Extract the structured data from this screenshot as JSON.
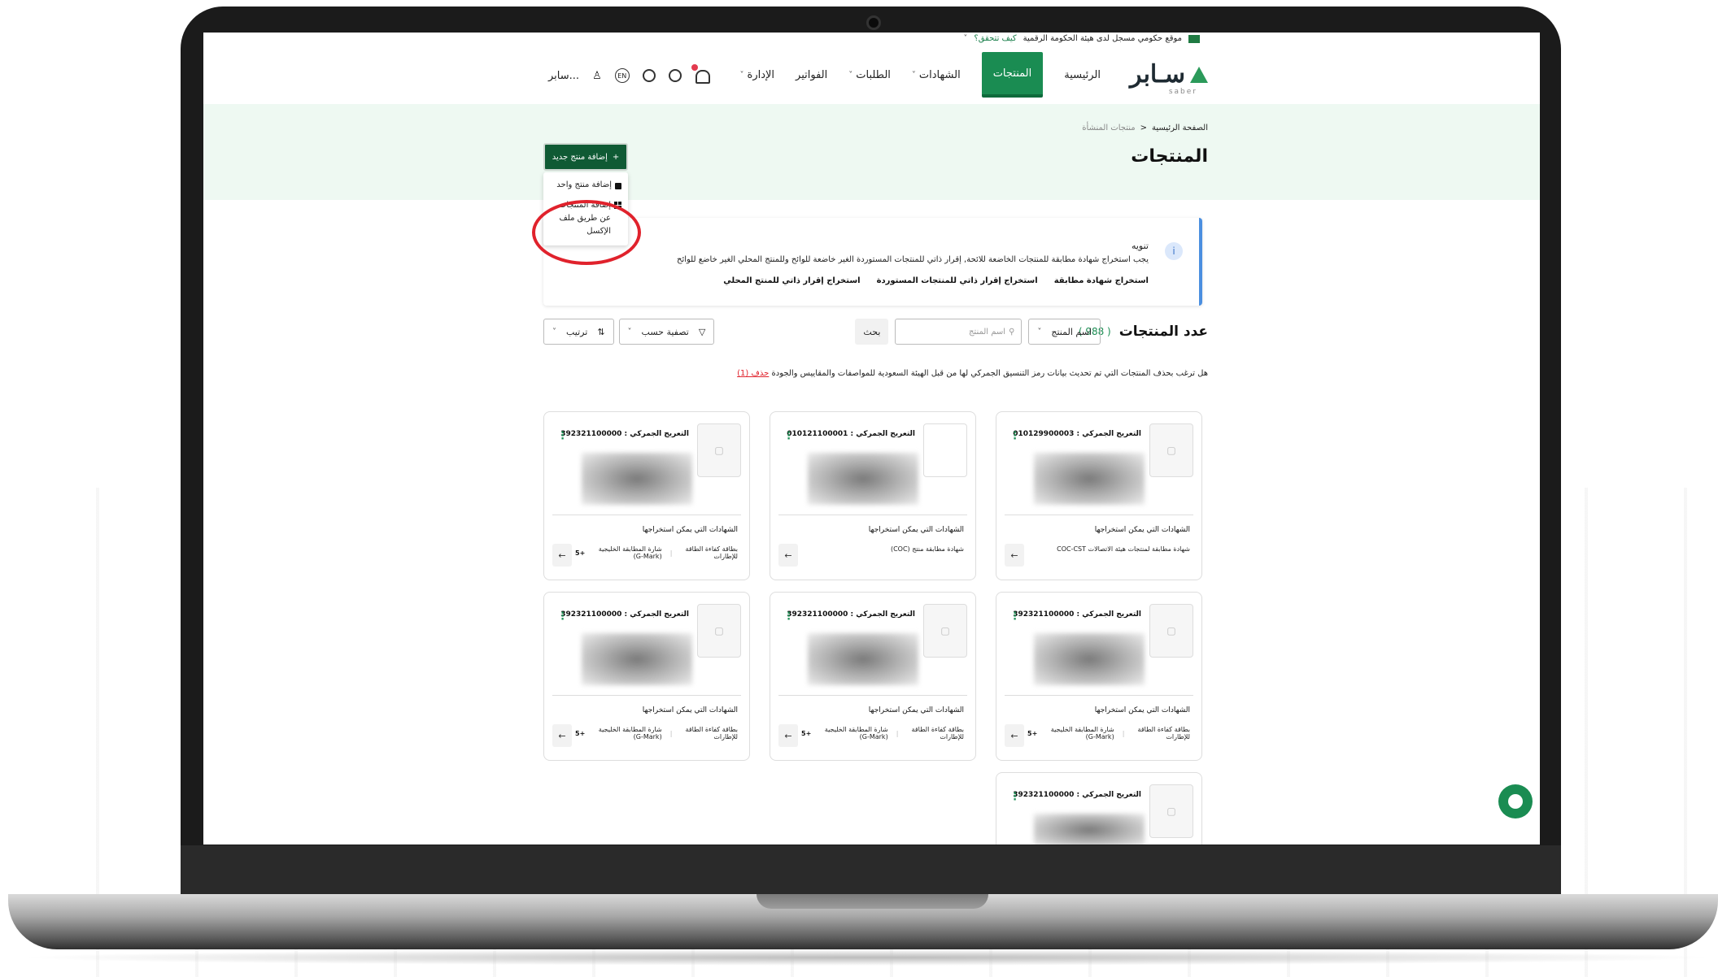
{
  "gov_bar": {
    "text": "موقع حكومي مسجل لدى هيئة الحكومة الرقمية",
    "link": "كيف تتحقق؟"
  },
  "brand": {
    "name": "سـابر",
    "sub": "saber"
  },
  "nav": {
    "items": [
      {
        "label": "الرئيسية",
        "active": false,
        "has_menu": false
      },
      {
        "label": "المنتجات",
        "active": true,
        "has_menu": false
      },
      {
        "label": "الشهادات",
        "active": false,
        "has_menu": true
      },
      {
        "label": "الطلبات",
        "active": false,
        "has_menu": true
      },
      {
        "label": "الفواتير",
        "active": false,
        "has_menu": false
      },
      {
        "label": "الإدارة",
        "active": false,
        "has_menu": true
      }
    ],
    "lang": "EN",
    "user": "سابر..."
  },
  "breadcrumb": {
    "home": "الصفحة الرئيسية",
    "separator": "<",
    "current": "منتجات المنشأة"
  },
  "page_title": "المنتجات",
  "add_button": {
    "label": "إضافة منتج جديد",
    "icon": "+"
  },
  "dropdown": {
    "single": "إضافة منتج واحد",
    "excel": "إضافة المنتجات عن طريق ملف الإكسل"
  },
  "notice": {
    "title": "تنويه",
    "text": "يجب استخراج شهادة مطابقة للمنتجات الخاضعة للائحة, إقرار ذاتي للمنتجات المستوردة الغير خاضعة للوائح وللمنتج المحلي الغير خاضع للوائح",
    "links": [
      "استخراج شهادة مطابقة",
      "استخراج إقرار ذاتي للمنتجات المستوردة",
      "استخراج إقرار ذاتي للمنتج المحلي"
    ]
  },
  "count": {
    "label": "عدد المنتجات",
    "value": "( 988 )"
  },
  "filters": {
    "field_select": "اسم المنتج",
    "search_placeholder": "اسم المنتج",
    "search_button": "بحث",
    "filter_by": "تصفية حسب",
    "sort": "ترتيب"
  },
  "question": {
    "text": "هل ترغب بحذف المنتجات التي تم تحديث بيانات رمز التنسيق الجمركي لها من قبل الهيئة السعودية للمواصفات والمقاييس والجودة",
    "link": "حذف (1)"
  },
  "cards": [
    {
      "tariff": "التعريج الجمركي : 010129900003",
      "certs_label": "الشهادات التي يمكن استخراجها",
      "certs": [
        "شهادة مطابقة لمنتجات هيئة الاتصالات COC-CST"
      ],
      "more": ""
    },
    {
      "tariff": "التعريج الجمركي : 010121100001",
      "certs_label": "الشهادات التي يمكن استخراجها",
      "certs": [
        "شهادة مطابقة منتج (COC)"
      ],
      "more": ""
    },
    {
      "tariff": "التعريج الجمركي : 392321100000",
      "certs_label": "الشهادات التي يمكن استخراجها",
      "certs": [
        "بطاقة كفاءة الطاقة للإطارات",
        "شارة المطابقة الخليجية (G-Mark)"
      ],
      "more": "+5"
    },
    {
      "tariff": "التعريج الجمركي : 392321100000",
      "certs_label": "الشهادات التي يمكن استخراجها",
      "certs": [
        "بطاقة كفاءة الطاقة للإطارات",
        "شارة المطابقة الخليجية (G-Mark)"
      ],
      "more": "+5"
    },
    {
      "tariff": "التعريج الجمركي : 392321100000",
      "certs_label": "الشهادات التي يمكن استخراجها",
      "certs": [
        "بطاقة كفاءة الطاقة للإطارات",
        "شارة المطابقة الخليجية (G-Mark)"
      ],
      "more": "+5"
    },
    {
      "tariff": "التعريج الجمركي : 392321100000",
      "certs_label": "الشهادات التي يمكن استخراجها",
      "certs": [
        "بطاقة كفاءة الطاقة للإطارات",
        "شارة المطابقة الخليجية (G-Mark)"
      ],
      "more": "+5"
    },
    {
      "tariff": "التعريج الجمركي : 392321100000",
      "certs_label": "",
      "certs": [],
      "more": ""
    }
  ],
  "colors": {
    "brand_green": "#1a8c52",
    "dark_green": "#0f5a34",
    "hero_bg": "#eef9f2",
    "notice_accent": "#4b8fe0",
    "highlight_red": "#e0222c"
  }
}
